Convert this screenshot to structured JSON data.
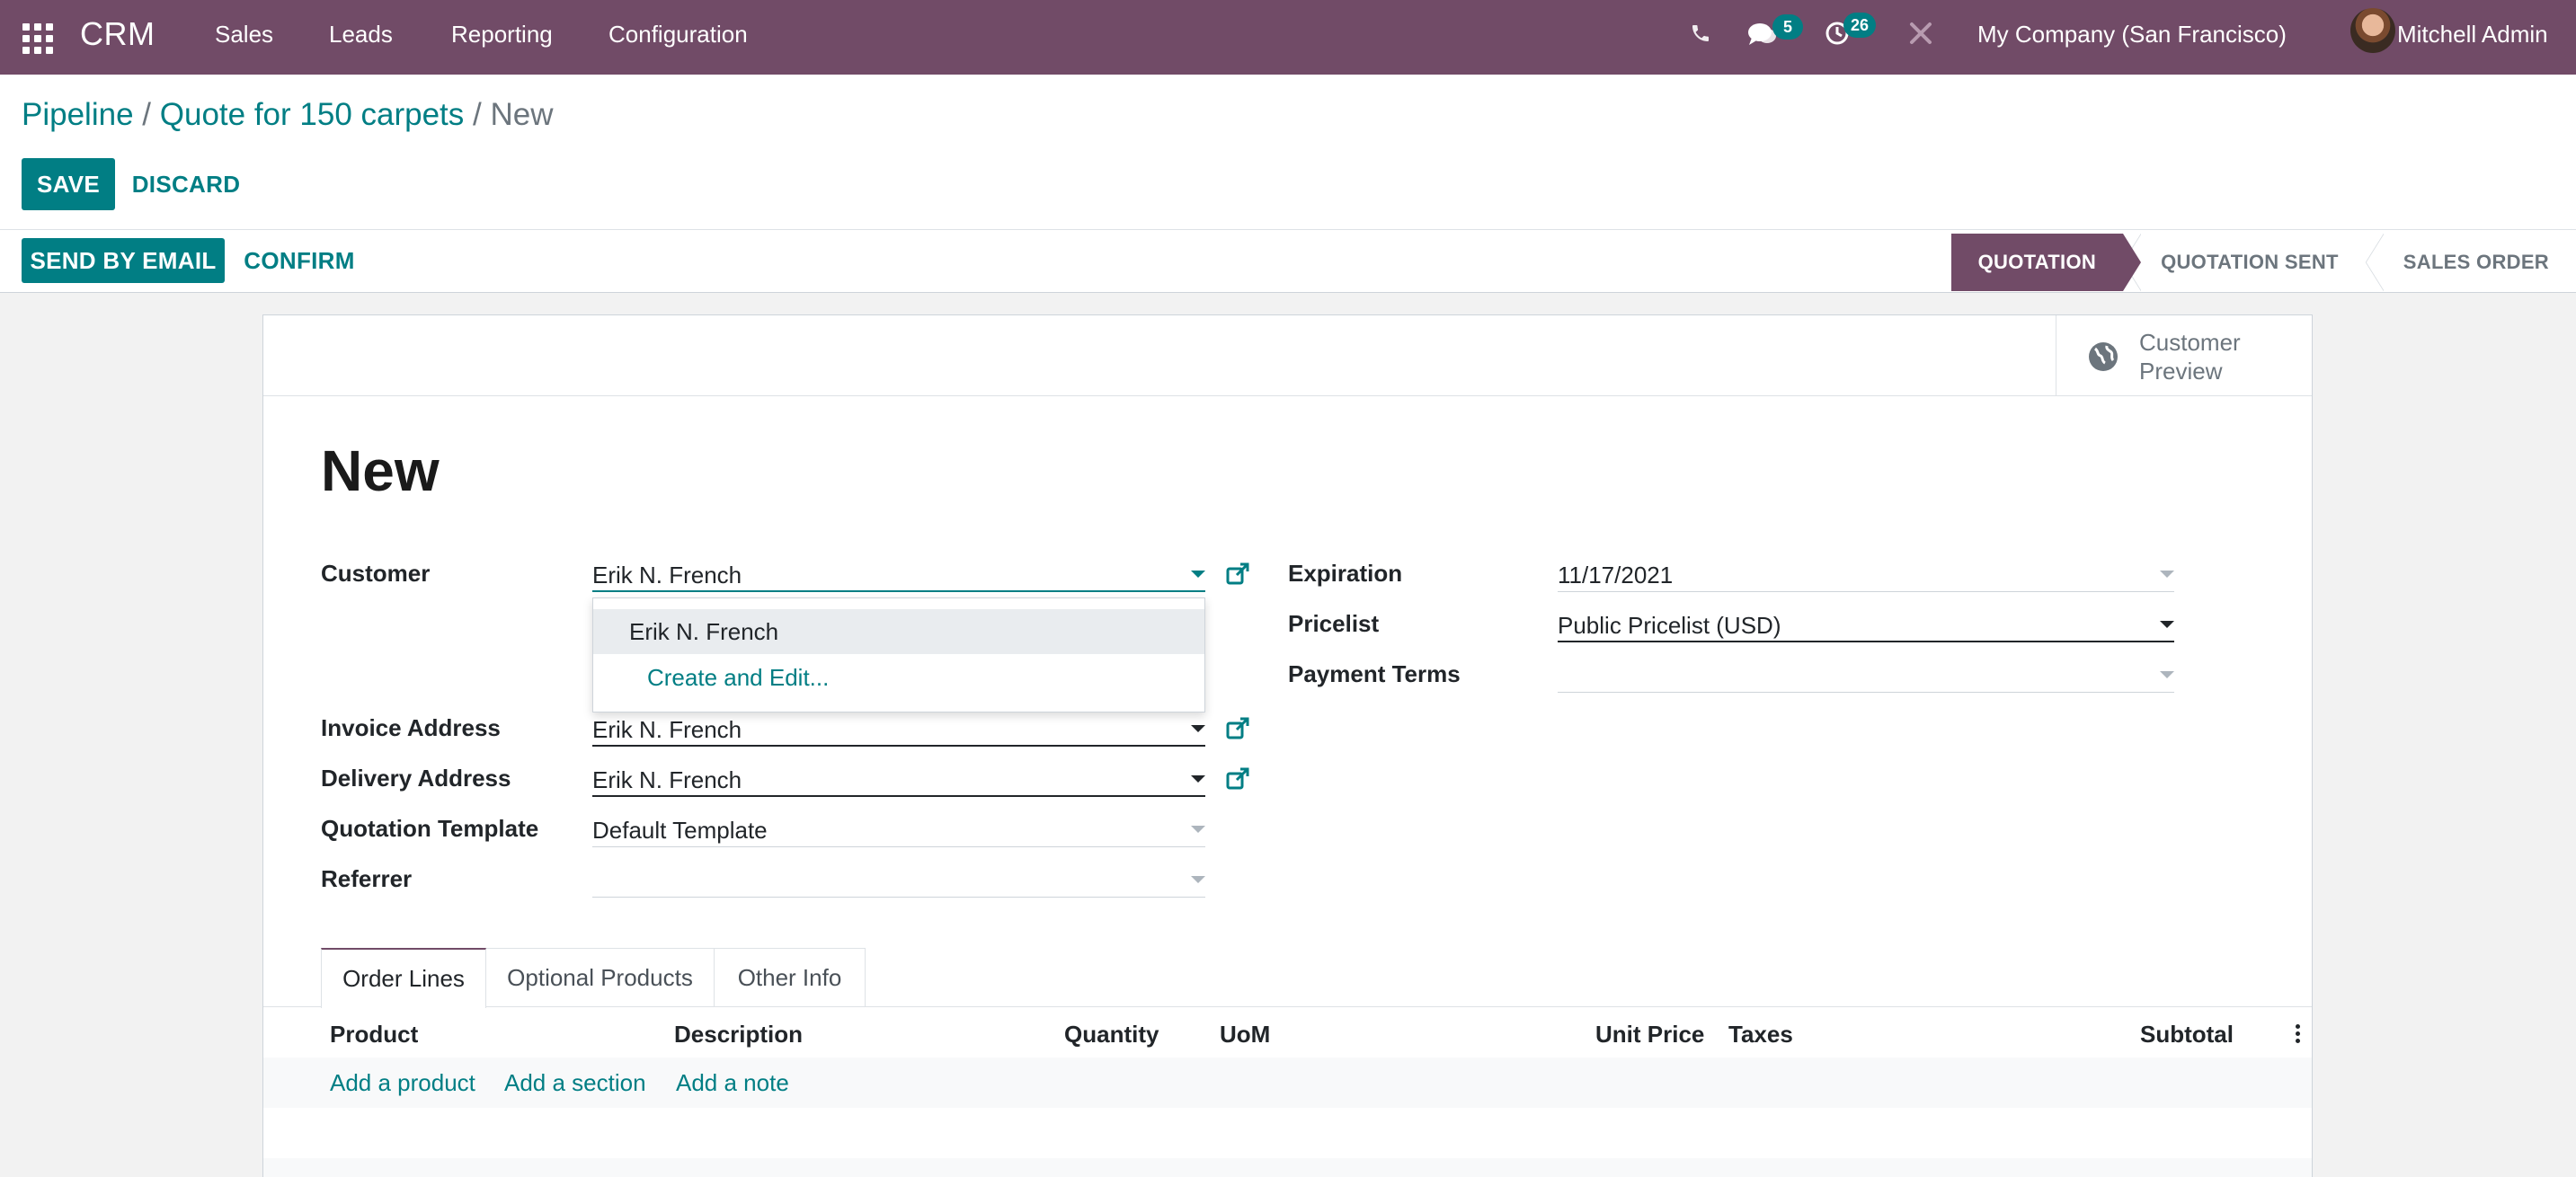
{
  "navbar": {
    "app_name": "CRM",
    "menu": [
      "Sales",
      "Leads",
      "Reporting",
      "Configuration"
    ],
    "messages_count": "5",
    "activities_count": "26",
    "company": "My Company (San Francisco)",
    "user": "Mitchell Admin",
    "icons": [
      "apps-grid-icon",
      "phone-icon",
      "chat-icon",
      "clock-icon",
      "debug-icon"
    ]
  },
  "breadcrumb": {
    "items": [
      "Pipeline",
      "Quote for 150 carpets"
    ],
    "separator": "/",
    "current": "New"
  },
  "actions": {
    "save": "Save",
    "discard": "Discard"
  },
  "header_buttons": {
    "send_email": "Send by Email",
    "confirm": "Confirm"
  },
  "statusbar": {
    "stages": [
      "Quotation",
      "Quotation Sent",
      "Sales Order"
    ],
    "active": "Quotation"
  },
  "smart_button": {
    "line1": "Customer",
    "line2": "Preview"
  },
  "form": {
    "title": "New",
    "customer": {
      "label": "Customer",
      "value": "Erik N. French"
    },
    "invoice_address": {
      "label": "Invoice Address",
      "value": "Erik N. French"
    },
    "delivery_address": {
      "label": "Delivery Address",
      "value": "Erik N. French"
    },
    "quotation_template": {
      "label": "Quotation Template",
      "value": "Default Template"
    },
    "referrer": {
      "label": "Referrer",
      "value": ""
    },
    "expiration": {
      "label": "Expiration",
      "value": "11/17/2021"
    },
    "pricelist": {
      "label": "Pricelist",
      "value": "Public Pricelist (USD)"
    },
    "payment_terms": {
      "label": "Payment Terms",
      "value": ""
    }
  },
  "customer_dropdown": {
    "options": [
      "Erik N. French"
    ],
    "create_edit": "Create and Edit..."
  },
  "tabs": [
    "Order Lines",
    "Optional Products",
    "Other Info"
  ],
  "order_lines": {
    "columns": [
      "Product",
      "Description",
      "Quantity",
      "UoM",
      "Unit Price",
      "Taxes",
      "Subtotal"
    ],
    "add_product": "Add a product",
    "add_section": "Add a section",
    "add_note": "Add a note"
  },
  "colors": {
    "brand": "#714b67",
    "accent": "#017e84"
  }
}
